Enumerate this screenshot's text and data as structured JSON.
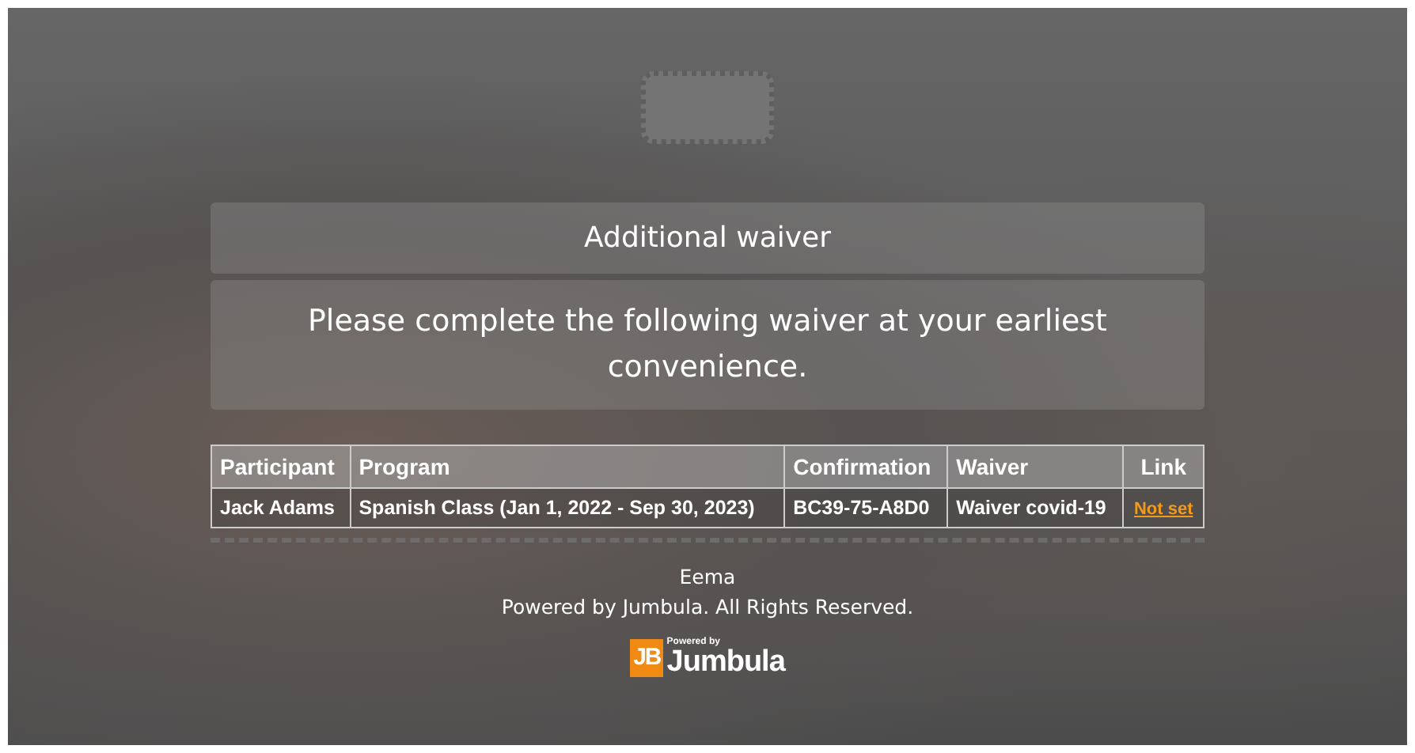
{
  "header": {
    "title": "Additional waiver",
    "message": "Please complete the following waiver at your earliest convenience."
  },
  "table": {
    "columns": [
      "Participant",
      "Program",
      "Confirmation",
      "Waiver",
      "Link"
    ],
    "rows": [
      {
        "participant": "Jack Adams",
        "program": "Spanish Class (Jan 1, 2022 - Sep 30, 2023)",
        "confirmation": "BC39-75-A8D0",
        "waiver": "Waiver covid-19",
        "link": "Not set"
      }
    ]
  },
  "footer": {
    "organization": "Eema",
    "copyright": "Powered by Jumbula. All Rights Reserved.",
    "logo": {
      "mark": "JB",
      "tagline": "Powered by",
      "name": "Jumbula"
    }
  }
}
